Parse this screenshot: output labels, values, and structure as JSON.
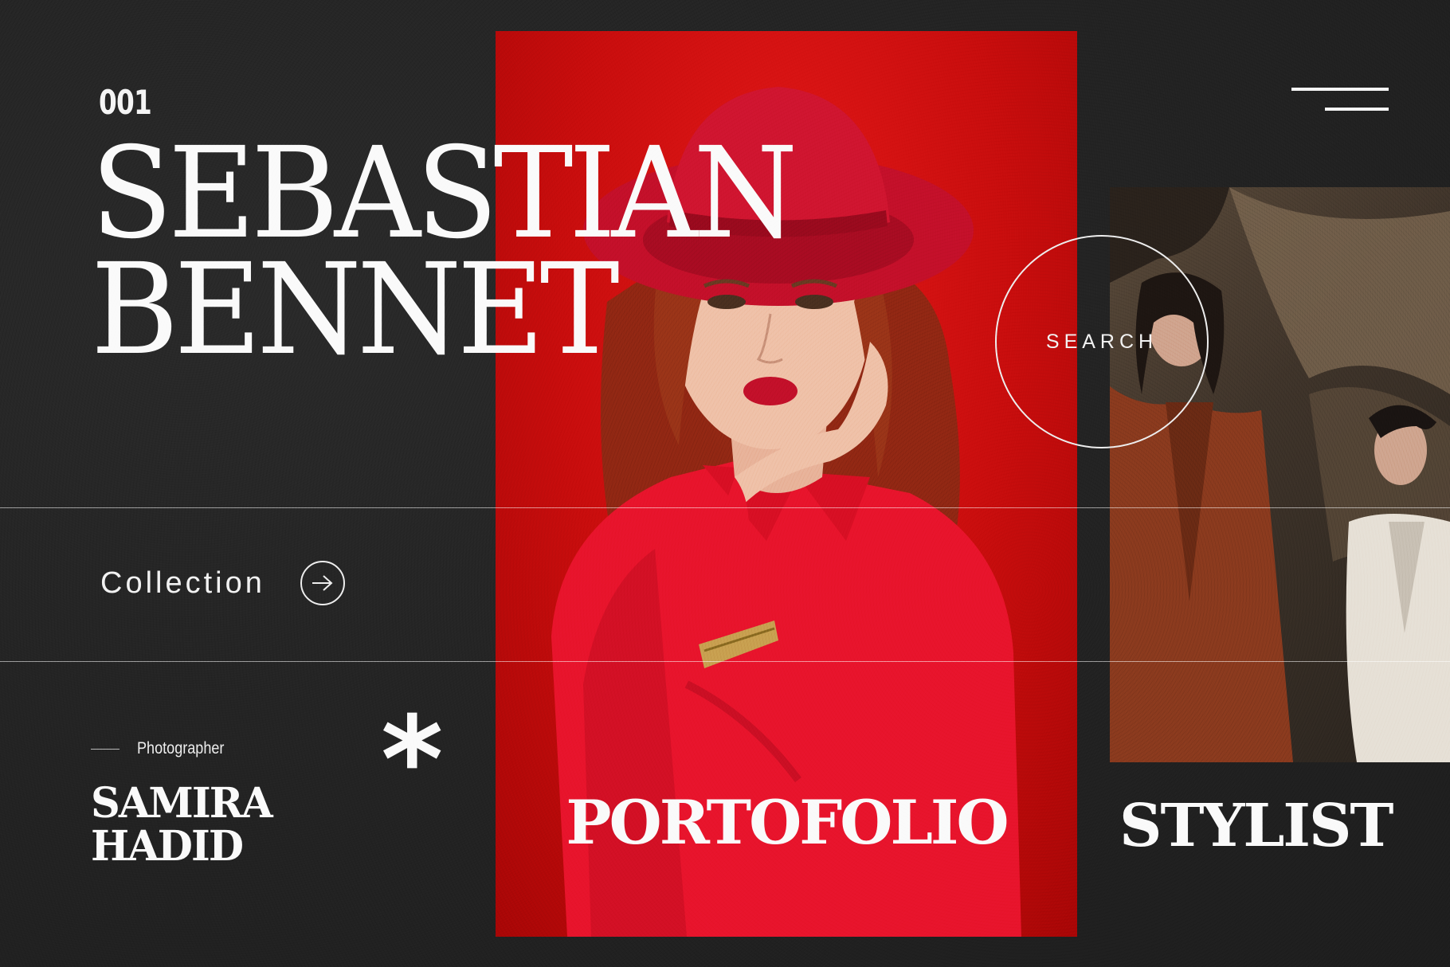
{
  "header": {
    "issue_number": "001",
    "menu_icon": "hamburger-menu-icon"
  },
  "hero": {
    "name_line1": "SEBASTIAN",
    "name_line2": "BENNET",
    "search_label": "SEARCH"
  },
  "collection": {
    "label": "Collection",
    "arrow_icon": "arrow-right-circle-icon"
  },
  "credit": {
    "role": "Photographer",
    "name_line1": "SAMIRA",
    "name_line2": "HADID",
    "asterisk": "*"
  },
  "footer": {
    "portfolio": "PORTOFOLIO",
    "stylist": "STYLIST"
  },
  "colors": {
    "background": "#232323",
    "accent_red": "#d21010",
    "text": "#fafafa"
  }
}
